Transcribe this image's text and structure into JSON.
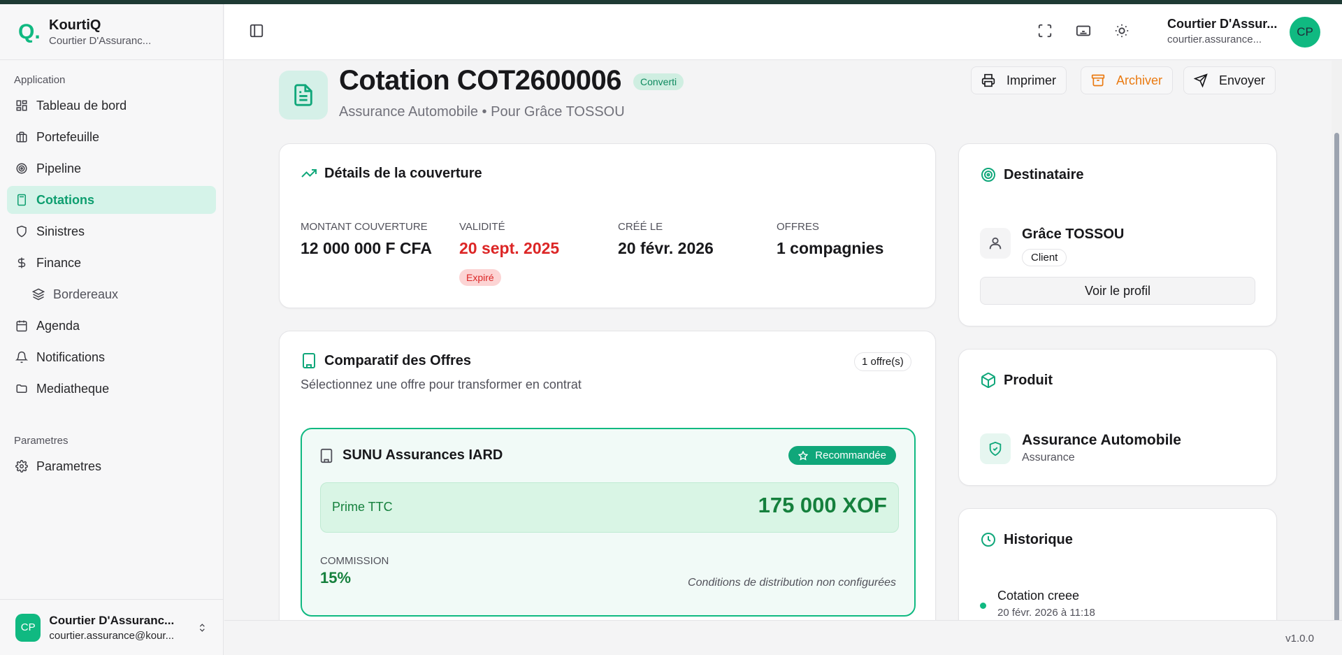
{
  "app": {
    "name": "KourtiQ",
    "subtitle": "Courtier D'Assuranc...",
    "logo": "Q."
  },
  "sidebar": {
    "section_application": "Application",
    "section_parametres": "Parametres",
    "items": [
      {
        "label": "Tableau de bord",
        "icon": "dashboard-icon"
      },
      {
        "label": "Portefeuille",
        "icon": "briefcase-icon"
      },
      {
        "label": "Pipeline",
        "icon": "target-icon"
      },
      {
        "label": "Cotations",
        "icon": "calculator-icon",
        "active": true
      },
      {
        "label": "Sinistres",
        "icon": "shield-icon"
      },
      {
        "label": "Finance",
        "icon": "dollar-icon"
      },
      {
        "label": "Bordereaux",
        "icon": "layers-icon",
        "sub": true
      },
      {
        "label": "Agenda",
        "icon": "calendar-icon"
      },
      {
        "label": "Notifications",
        "icon": "bell-icon"
      },
      {
        "label": "Mediatheque",
        "icon": "folder-icon"
      }
    ],
    "settings_item": {
      "label": "Parametres",
      "icon": "gear-icon"
    },
    "footer": {
      "initials": "CP",
      "name": "Courtier D'Assuranc...",
      "email": "courtier.assurance@kour..."
    }
  },
  "header": {
    "user_name": "Courtier D'Assur...",
    "user_email": "courtier.assurance...",
    "initials": "CP"
  },
  "quote": {
    "title": "Cotation COT2600006",
    "status": "Converti",
    "subtitle": "Assurance Automobile • Pour Grâce TOSSOU",
    "actions": {
      "print": "Imprimer",
      "archive": "Archiver",
      "send": "Envoyer"
    }
  },
  "coverage": {
    "title": "Détails de la couverture",
    "amount_label": "MONTANT COUVERTURE",
    "amount_value": "12 000 000 F CFA",
    "validity_label": "VALIDITÉ",
    "validity_value": "20 sept. 2025",
    "validity_status": "Expiré",
    "created_label": "CRÉÉ LE",
    "created_value": "20 févr. 2026",
    "offers_label": "OFFRES",
    "offers_value": "1 compagnies"
  },
  "comparison": {
    "title": "Comparatif des Offres",
    "count": "1 offre(s)",
    "hint": "Sélectionnez une offre pour transformer en contrat",
    "offer": {
      "company": "SUNU Assurances IARD",
      "badge": "Recommandée",
      "prime_label": "Prime TTC",
      "prime_value": "175 000 XOF",
      "commission_label": "COMMISSION",
      "commission_value": "15%",
      "conditions": "Conditions de distribution non configurées"
    }
  },
  "recipient": {
    "title": "Destinataire",
    "name": "Grâce TOSSOU",
    "role": "Client",
    "profile_button": "Voir le profil"
  },
  "product": {
    "title": "Produit",
    "name": "Assurance Automobile",
    "type": "Assurance"
  },
  "history": {
    "title": "Historique",
    "entries": [
      {
        "title": "Cotation creee",
        "date": "20 févr. 2026 à 11:18"
      }
    ]
  },
  "footer": {
    "version": "v1.0.0"
  },
  "colors": {
    "accent": "#10b981",
    "danger": "#dc2626",
    "warning": "#ea7a11"
  }
}
